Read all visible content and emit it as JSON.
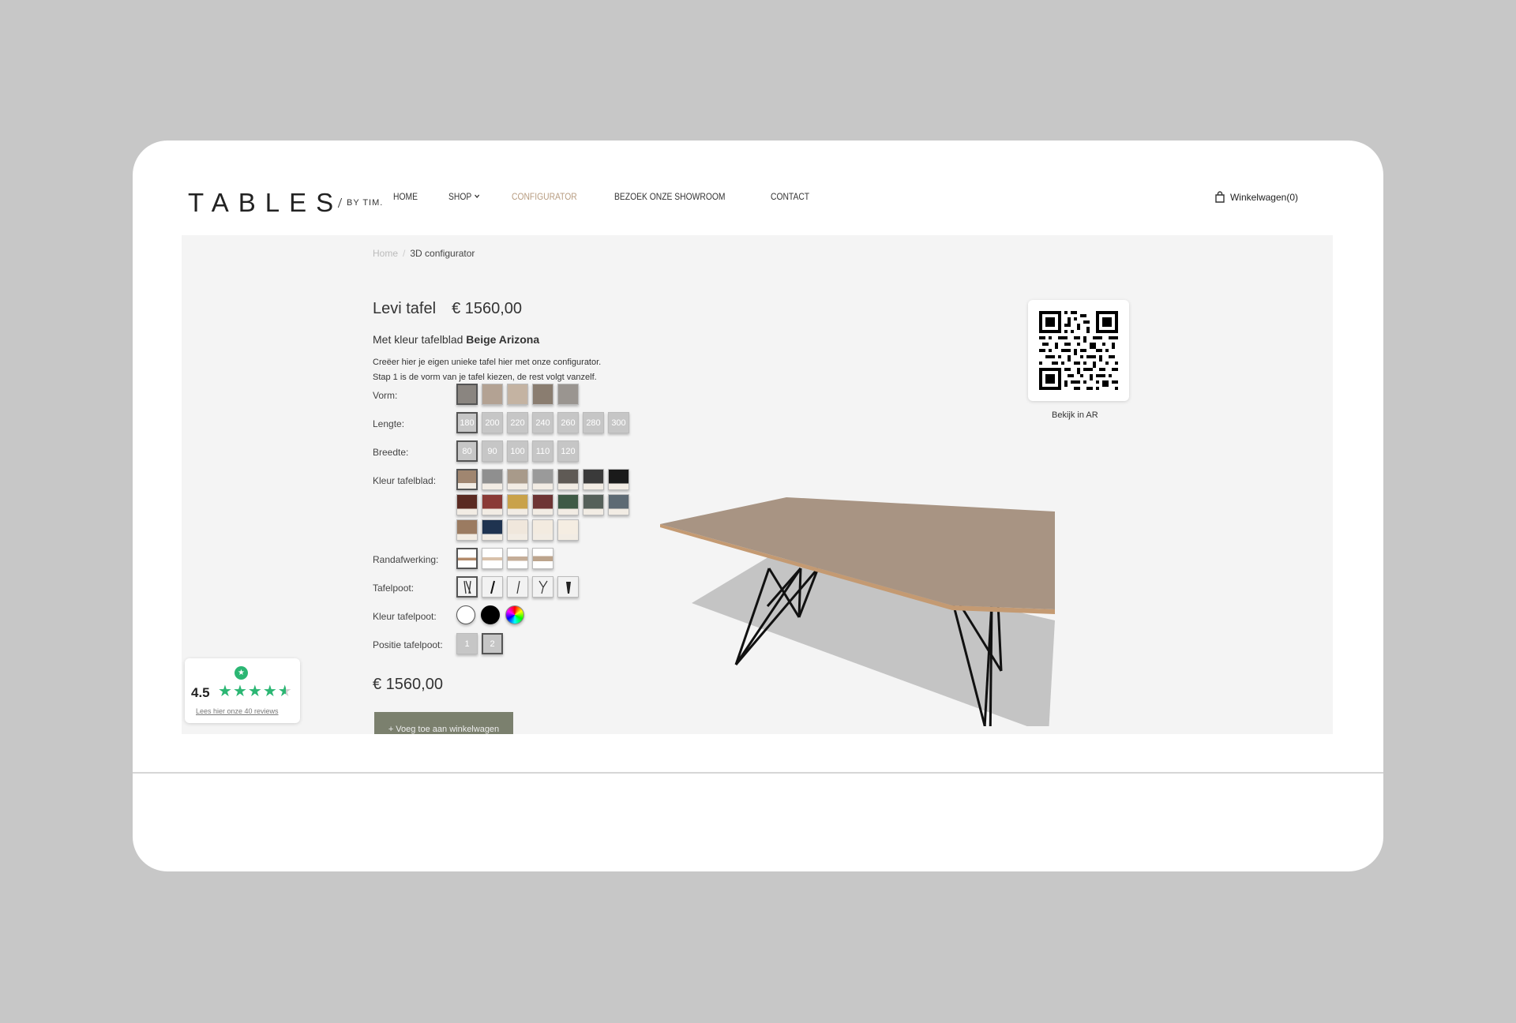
{
  "logo": {
    "main": "TABLES",
    "sub": "BY TIM."
  },
  "nav": {
    "items": [
      "HOME",
      "SHOP",
      "CONFIGURATOR",
      "BEZOEK ONZE SHOWROOM",
      "CONTACT"
    ],
    "active": "CONFIGURATOR"
  },
  "cart": {
    "label": "Winkelwagen(0)",
    "icon": "shopping-bag-icon"
  },
  "breadcrumb": {
    "home": "Home",
    "separator": "/",
    "current": "3D configurator"
  },
  "product": {
    "name": "Levi tafel",
    "price": "€ 1560,00",
    "subtitle_prefix": "Met kleur tafelblad",
    "color_name": "Beige Arizona",
    "description_line1": "Creëer hier je eigen unieke tafel hier met onze configurator.",
    "description_line2": "Stap 1 is de vorm van je tafel kiezen, de rest volgt vanzelf."
  },
  "options": {
    "vorm_label": "Vorm:",
    "lengte_label": "Lengte:",
    "lengte_values": [
      "180",
      "200",
      "220",
      "240",
      "260",
      "280",
      "300"
    ],
    "breedte_label": "Breedte:",
    "breedte_values": [
      "80",
      "90",
      "100",
      "110",
      "120"
    ],
    "kleur_label": "Kleur tafelblad:",
    "rand_label": "Randafwerking:",
    "poot_label": "Tafelpoot:",
    "kleur_poot_label": "Kleur tafelpoot:",
    "positie_label": "Positie tafelpoot:",
    "positie_values": [
      "1",
      "2"
    ],
    "top_colors": [
      "#a08670",
      "#8f8f8f",
      "#a89a8a",
      "#9a9a9a",
      "#5f5a55",
      "#3a3a3a",
      "#1a1a1a",
      "#5a2a22",
      "#8a3a36",
      "#c9a24a",
      "#6e3434",
      "#3e5a46",
      "#55605a",
      "#5d6a74",
      "#9b7b61",
      "#1f3350",
      "#f0e7dc",
      "#f3ebe0",
      "#f5ede2"
    ]
  },
  "price_bottom": "€ 1560,00",
  "add_to_cart": "+ Voeg toe aan winkelwagen",
  "ar": {
    "label": "Bekijk in AR"
  },
  "reviews": {
    "score": "4.5",
    "link": "Lees hier onze 40 reviews",
    "rating": 4.5
  },
  "colors": {
    "accent": "#b79c80",
    "button": "#7b806e",
    "trustpilot": "#2bb673",
    "tabletop": "#a89483"
  }
}
